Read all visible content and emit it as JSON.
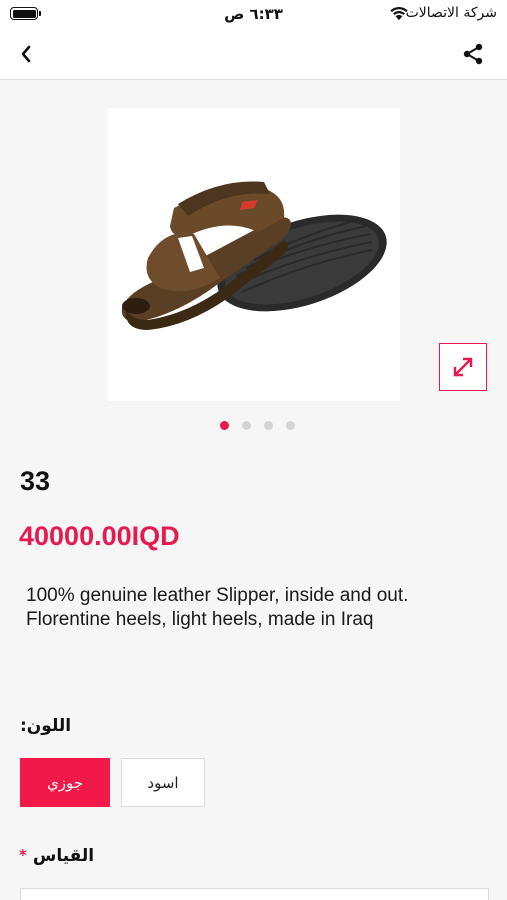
{
  "status_bar": {
    "carrier": "شركة الاتصالات",
    "time": "٦:٣٣ ص",
    "battery_level": 1.0,
    "icons": [
      "battery-icon",
      "wifi-icon"
    ]
  },
  "nav": {
    "icons": [
      "chevron-left-icon",
      "share-icon"
    ]
  },
  "product": {
    "image_description_icon": "sandal-image",
    "carousel": {
      "pages": 4,
      "active_index": 0
    },
    "name": "33",
    "price": "40000.00IQD",
    "description_line1": "100% genuine leather Slipper, inside and out.",
    "description_line2": "Florentine heels, light heels, made in Iraq"
  },
  "options": {
    "color_label": "اللون:",
    "colors": [
      {
        "label": "جوزي",
        "selected": true
      },
      {
        "label": "اسود",
        "selected": false
      }
    ],
    "size_label": "القياس",
    "size_required_mark": "*",
    "size_value": ""
  },
  "theme": {
    "accent": "#e8194f",
    "background": "#f6f6f6"
  }
}
